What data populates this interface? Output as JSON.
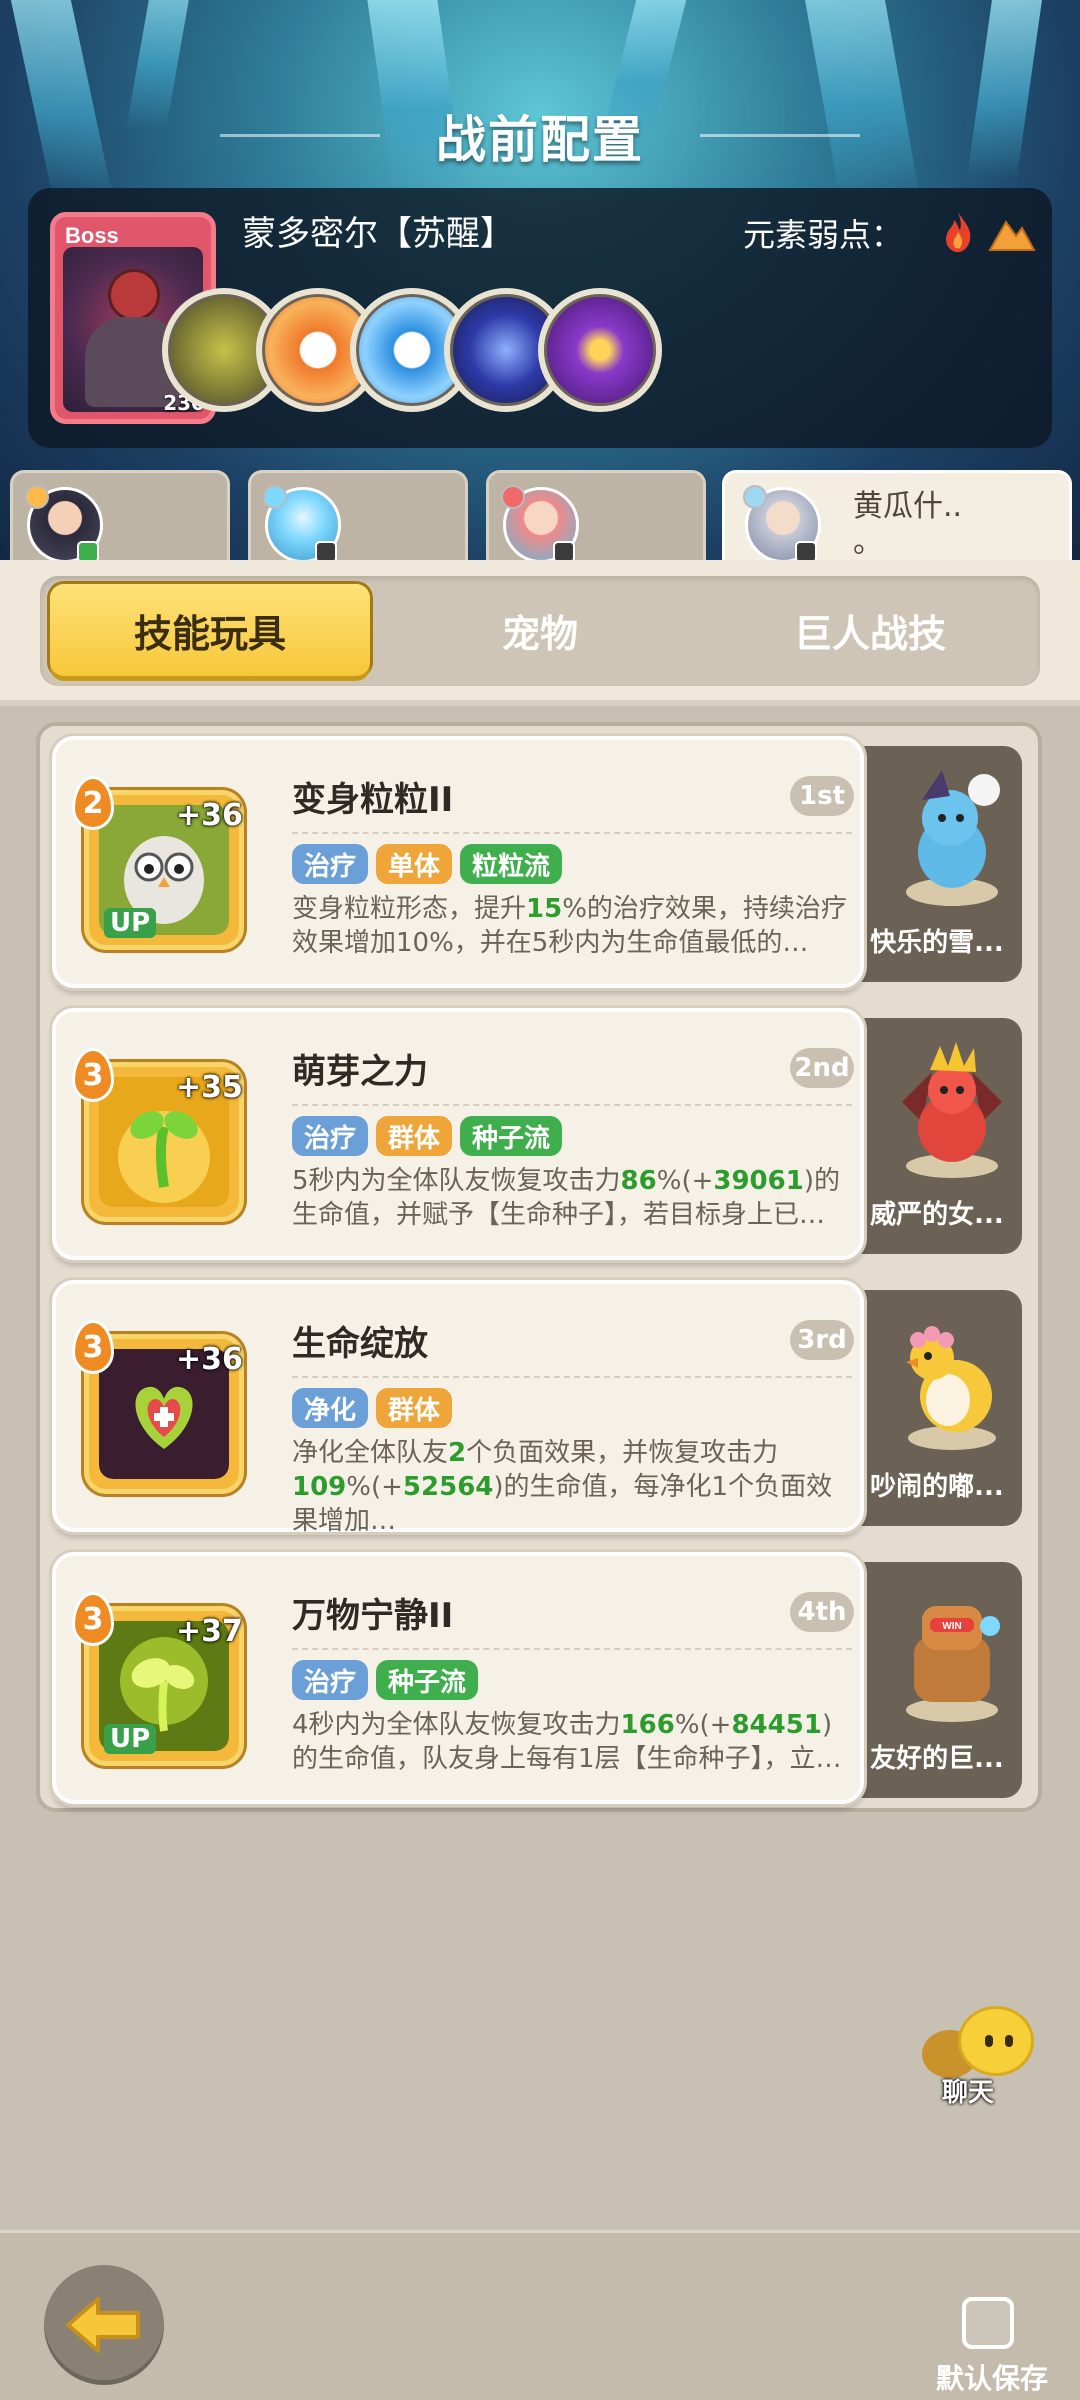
{
  "header": {
    "title": "战前配置"
  },
  "boss": {
    "tag": "Boss",
    "level": "230",
    "name": "蒙多密尔【苏醒】",
    "weakness_label": "元素弱点：",
    "weakness_icons": [
      "fire-icon",
      "earth-icon"
    ],
    "skill_icons": [
      "stone-golem-skill-icon",
      "orange-earth-skill-icon",
      "blue-earth-skill-icon",
      "dark-slash-skill-icon",
      "purple-eye-skill-icon"
    ]
  },
  "team_tabs": [
    {
      "avatar": "hero-dark-hair-avatar"
    },
    {
      "avatar": "hero-ice-avatar"
    },
    {
      "avatar": "hero-flower-avatar"
    },
    {
      "avatar": "hero-silver-hair-avatar",
      "name": "黄瓜什..",
      "name_line2": "。",
      "selected": true
    }
  ],
  "segment": {
    "tabs": [
      "技能玩具",
      "宠物",
      "巨人战技"
    ],
    "active_index": 0
  },
  "skills": [
    {
      "name": "变身粒粒II",
      "rank": "1st",
      "level": "2",
      "plus": "+36",
      "up": "UP",
      "tags": [
        "治疗",
        "单体",
        "粒粒流"
      ],
      "desc_parts": [
        "变身粒粒形态，提升",
        "15",
        "%的治疗效果，持续治疗效果增加10%，并在5秒内为生命值最低的…"
      ],
      "pet_name": "快乐的雪..."
    },
    {
      "name": "萌芽之力",
      "rank": "2nd",
      "level": "3",
      "plus": "+35",
      "up": "",
      "tags": [
        "治疗",
        "群体",
        "种子流"
      ],
      "desc_parts": [
        "5秒内为全体队友恢复攻击力",
        "86",
        "%(+",
        "39061",
        ")的生命值，并赋予【生命种子】，若目标身上已…"
      ],
      "pet_name": "威严的女..."
    },
    {
      "name": "生命绽放",
      "rank": "3rd",
      "level": "3",
      "plus": "+36",
      "up": "",
      "tags": [
        "净化",
        "群体"
      ],
      "desc_parts": [
        "净化全体队友",
        "2",
        "个负面效果，并恢复攻击力",
        "109",
        "%(+",
        "52564",
        ")的生命值，每净化1个负面效果增加…"
      ],
      "pet_name": "吵闹的嘟..."
    },
    {
      "name": "万物宁静II",
      "rank": "4th",
      "level": "3",
      "plus": "+37",
      "up": "UP",
      "tags": [
        "治疗",
        "种子流"
      ],
      "desc_parts": [
        "4秒内为全体队友恢复攻击力",
        "166",
        "%(+",
        "84451",
        ")的生命值，队友身上每有1层【生命种子】，立…"
      ],
      "pet_name": "友好的巨..."
    }
  ],
  "chat": {
    "label": "聊天"
  },
  "footer": {
    "save_label": "默认保存",
    "back_icon": "back-arrow-icon"
  },
  "colors": {
    "accent_yellow": "#f6c739",
    "tag_blue": "#6a9fd8",
    "tag_orange": "#f0a53a",
    "tag_green": "#3fae4c",
    "highlight_green": "#2c9d2c"
  }
}
